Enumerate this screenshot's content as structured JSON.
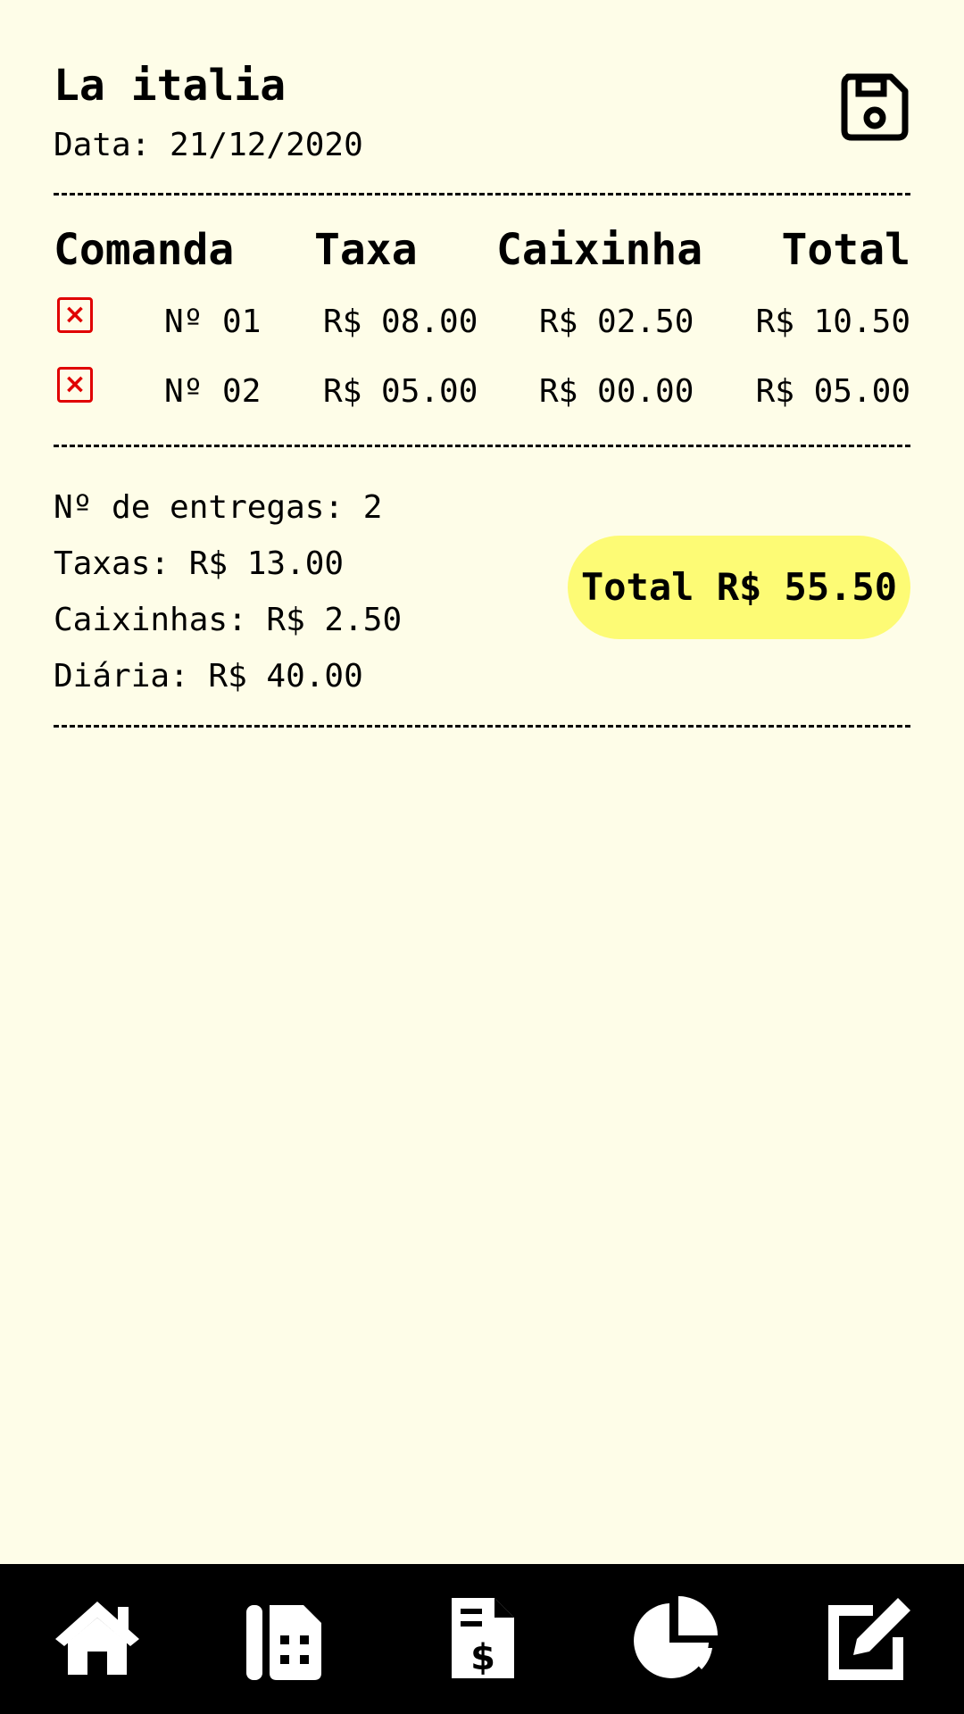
{
  "header": {
    "title": "La italia",
    "date": "Data: 21/12/2020",
    "save_icon": "floppy-disk-icon"
  },
  "table": {
    "columns": [
      "Comanda",
      "Taxa",
      "Caixinha",
      "Total"
    ],
    "rows": [
      {
        "comanda": "Nº 01",
        "taxa": "R$ 08.00",
        "caixinha": "R$ 02.50",
        "total": "R$ 10.50"
      },
      {
        "comanda": "Nº 02",
        "taxa": "R$ 05.00",
        "caixinha": "R$ 00.00",
        "total": "R$ 05.00"
      }
    ],
    "delete_icon": "close-box-icon"
  },
  "summary": {
    "entregas": "Nº de entregas: 2",
    "taxas": "Taxas: R$ 13.00",
    "caixinhas": "Caixinhas: R$ 2.50",
    "diaria": "Diária: R$ 40.00",
    "total": "Total R$ 55.50"
  },
  "nav": {
    "items": [
      "home-icon",
      "calculator-icon",
      "invoice-icon",
      "pie-chart-icon",
      "edit-icon"
    ]
  },
  "colors": {
    "background": "#fefde8",
    "total_pill": "#fdfb75",
    "delete": "#e00000",
    "nav": "#000000"
  }
}
